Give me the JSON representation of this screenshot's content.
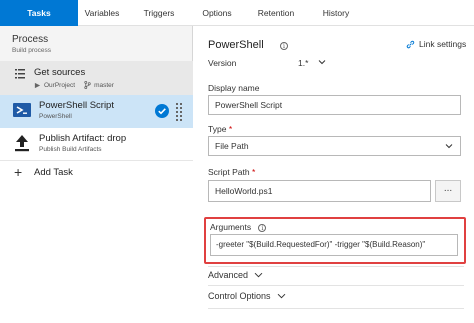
{
  "tabs": [
    {
      "label": "Tasks",
      "active": true
    },
    {
      "label": "Variables",
      "active": false
    },
    {
      "label": "Triggers",
      "active": false
    },
    {
      "label": "Options",
      "active": false
    },
    {
      "label": "Retention",
      "active": false
    },
    {
      "label": "History",
      "active": false
    }
  ],
  "process": {
    "title": "Process",
    "subtitle": "Build process"
  },
  "get_sources": {
    "label": "Get sources",
    "project": "OurProject",
    "branch": "master"
  },
  "tasks": [
    {
      "name": "PowerShell Script",
      "sub": "PowerShell",
      "selected": true,
      "icon": "powershell-icon"
    },
    {
      "name": "Publish Artifact: drop",
      "sub": "Publish Build Artifacts",
      "selected": false,
      "icon": "upload-icon"
    }
  ],
  "add_task": {
    "label": "Add Task"
  },
  "panel": {
    "title": "PowerShell",
    "link_settings": "Link settings",
    "version_label": "Version",
    "version_value": "1.*",
    "display_name_label": "Display name",
    "display_name_value": "PowerShell Script",
    "type_label": "Type",
    "type_value": "File Path",
    "script_path_label": "Script Path",
    "script_path_value": "HelloWorld.ps1",
    "browse_label": "...",
    "arguments_label": "Arguments",
    "arguments_value": "-greeter \"$(Build.RequestedFor)\" -trigger \"$(Build.Reason)\"",
    "advanced_label": "Advanced",
    "control_options_label": "Control Options",
    "required_mark": "*"
  },
  "colors": {
    "accent": "#0078d4",
    "highlight_border": "#e04040",
    "selected_row": "#cce4f7"
  }
}
